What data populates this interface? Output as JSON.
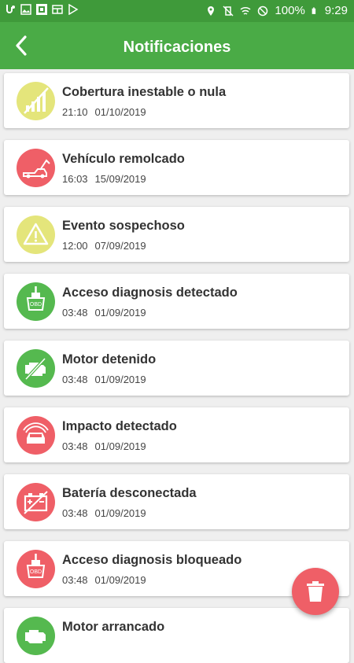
{
  "status_bar": {
    "battery": "100%",
    "time": "9:29",
    "left_icons": [
      "app-notification-icon",
      "image-icon",
      "app-badge-icon",
      "card-icon",
      "play-store-icon"
    ],
    "right_icons": [
      "location-icon",
      "vibrate-off-icon",
      "wifi-icon",
      "blocked-icon",
      "battery-icon"
    ]
  },
  "header": {
    "title": "Notificaciones",
    "back_icon": "back-arrow-icon"
  },
  "colors": {
    "appbar": "#4aab46",
    "statusbar": "#3f9a3a",
    "yellow": "#e4e57b",
    "red": "#ef5f67",
    "green": "#55b94f"
  },
  "notifications": [
    {
      "title": "Cobertura inestable o nula",
      "time": "21:10",
      "date": "01/10/2019",
      "color": "#e4e57b",
      "icon": "no-signal-icon"
    },
    {
      "title": "Vehículo remolcado",
      "time": "16:03",
      "date": "15/09/2019",
      "color": "#ef5f67",
      "icon": "tow-truck-icon"
    },
    {
      "title": "Evento sospechoso",
      "time": "12:00",
      "date": "07/09/2019",
      "color": "#e4e57b",
      "icon": "warning-icon"
    },
    {
      "title": "Acceso diagnosis detectado",
      "time": "03:48",
      "date": "01/09/2019",
      "color": "#55b94f",
      "icon": "obd-plug-icon"
    },
    {
      "title": "Motor detenido",
      "time": "03:48",
      "date": "01/09/2019",
      "color": "#55b94f",
      "icon": "engine-off-icon"
    },
    {
      "title": "Impacto detectado",
      "time": "03:48",
      "date": "01/09/2019",
      "color": "#ef5f67",
      "icon": "car-impact-icon"
    },
    {
      "title": "Batería desconectada",
      "time": "03:48",
      "date": "01/09/2019",
      "color": "#ef5f67",
      "icon": "battery-disconnected-icon"
    },
    {
      "title": "Acceso diagnosis bloqueado",
      "time": "03:48",
      "date": "01/09/2019",
      "color": "#ef5f67",
      "icon": "obd-plug-icon"
    },
    {
      "title": "Motor arrancado",
      "time": "",
      "date": "",
      "color": "#55b94f",
      "icon": "engine-on-icon"
    }
  ],
  "fab": {
    "icon": "trash-icon"
  }
}
